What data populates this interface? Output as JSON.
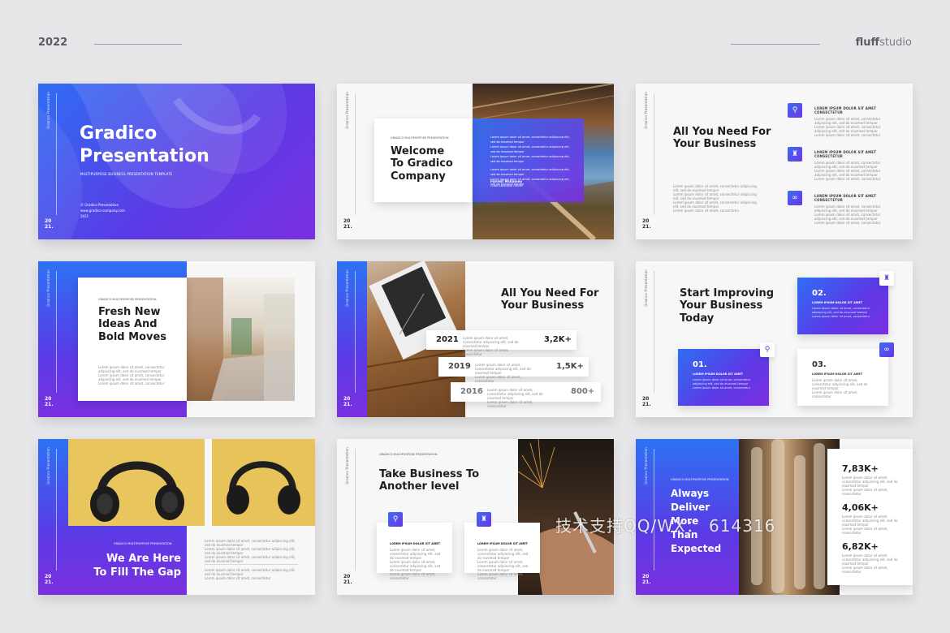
{
  "header": {
    "year": "2022",
    "brand_bold": "fluff",
    "brand_light": "studio"
  },
  "common": {
    "side_label": "Gradico Presentation",
    "year_top": "20",
    "year_bottom": "21.",
    "kicker": "GRADICO MULTIPURPOSE PRESENTATION",
    "lorem_title": "LOREM IPSUM DOLOR SIT AMET",
    "lorem_title_c": "LOREM IPSUM DOLOR SIT AMET CONSECTETUR",
    "lorem_line": "Lorem ipsum dolor sit amet, consectetur adipiscing elit, sed do eiusmod tempor",
    "lorem_short": "Lorem ipsum dolor sit amet, consectetur"
  },
  "slide1": {
    "title_1": "Gradico",
    "title_2": "Presentation",
    "subtitle": "MULTIPURPOSE BUSINESS PRESENTATION TEMPLATE",
    "meta_1": "© Gradico Presentation",
    "meta_2": "www.gradico-company.com",
    "meta_3": "2021"
  },
  "slide2": {
    "title_1": "Welcome",
    "title_2": "To Gradico",
    "title_3": "Company",
    "name": "Forrest Mckinney",
    "role": "Chief Executive Officer"
  },
  "slide3": {
    "title_1": "All You Need For",
    "title_2": "Your Business",
    "icons": [
      "search-icon",
      "chess-icon",
      "link-icon"
    ]
  },
  "slide4": {
    "title_1": "Fresh New",
    "title_2": "Ideas And",
    "title_3": "Bold Moves"
  },
  "slide5": {
    "title_1": "All You Need For",
    "title_2": "Your Business",
    "rows": [
      {
        "year": "2021",
        "value": "3,2K+"
      },
      {
        "year": "2019",
        "value": "1,5K+"
      },
      {
        "year": "2016",
        "value": "800+"
      }
    ]
  },
  "slide6": {
    "title_1": "Start Improving",
    "title_2": "Your Business",
    "title_3": "Today",
    "n1": "01.",
    "n2": "02.",
    "n3": "03."
  },
  "slide7": {
    "title_1": "We Are Here",
    "title_2": "To Fill The Gap"
  },
  "slide8": {
    "title_1": "Take Business To",
    "title_2": "Another level"
  },
  "slide9": {
    "title_1": "Always",
    "title_2": "Deliver",
    "title_3": "More",
    "title_4": "Than",
    "title_5": "Expected",
    "stats": [
      "7,83K+",
      "4,06K+",
      "6,82K+"
    ]
  },
  "watermark": "技术支持QQ/WX： 614316",
  "colors": {
    "accent_blue": "#2f6ef3",
    "accent_purple": "#7a2fe0"
  }
}
